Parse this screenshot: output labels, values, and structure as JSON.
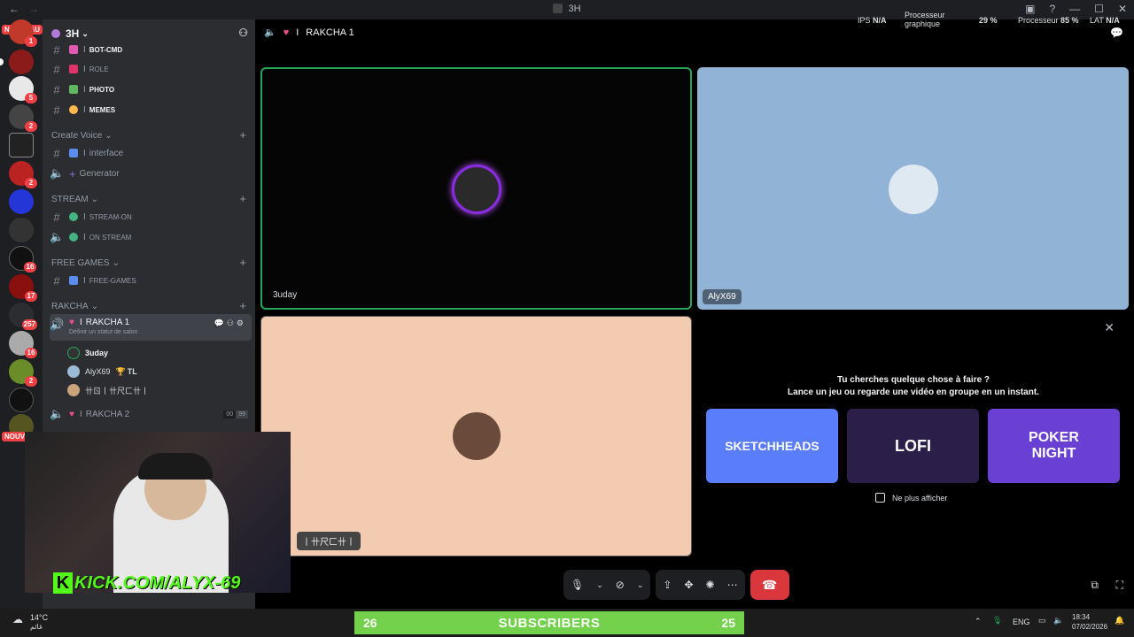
{
  "window": {
    "title": "3H"
  },
  "server": {
    "name": "3H"
  },
  "nouveau_label": "NOUVEAU",
  "server_badges": [
    "1",
    "5",
    "2",
    "2",
    "16",
    "17",
    "257",
    "16",
    "2"
  ],
  "channels": {
    "text_top": [
      {
        "label": "BOT-CMD",
        "color": "#e05bb0"
      },
      {
        "label": "ROLE",
        "color": "#e0336a"
      },
      {
        "label": "PHOTO",
        "color": "#5fb85f"
      },
      {
        "label": "MEMES",
        "color": "#ffb84d"
      }
    ],
    "create_voice": {
      "label": "Create Voice",
      "items": [
        {
          "label": "interface",
          "type": "text"
        },
        {
          "label": "Generator",
          "type": "voice"
        }
      ]
    },
    "stream": {
      "label": "STREAM",
      "items": [
        {
          "label": "STREAM-ON",
          "type": "text"
        },
        {
          "label": "ON STREAM",
          "type": "voice"
        }
      ]
    },
    "free_games": {
      "label": "FREE GAMES",
      "items": [
        {
          "label": "FREE-GAMES",
          "type": "text"
        }
      ]
    },
    "rakcha": {
      "label": "RAKCHA",
      "active": {
        "label": "RAKCHA 1",
        "status": "Définir un statut de salon"
      },
      "users": [
        {
          "name": "3uday"
        },
        {
          "name": "AlyX69",
          "tag": "TL"
        },
        {
          "name": "卄ㄖ丨卄尺ㄈ卄丨"
        }
      ],
      "next": {
        "label": "RAKCHA 2",
        "counter": [
          "00",
          "99"
        ]
      }
    },
    "separator": "I"
  },
  "call": {
    "channel_label": "RAKCHA 1",
    "stats": {
      "ips_label": "IPS",
      "ips_value": "N/A",
      "gpu_label": "Processeur graphique",
      "gpu_value": "29 %",
      "cpu_label": "Processeur",
      "cpu_value": "85 %",
      "lat_label": "LAT",
      "lat_value": "N/A"
    },
    "tiles": [
      {
        "name": "3uday"
      },
      {
        "name": "AlyX69"
      },
      {
        "name": "丨卄尺ㄈ卄丨"
      }
    ]
  },
  "activity": {
    "line1": "Tu cherches quelque chose à faire ?",
    "line2": "Lance un jeu ou regarde une vidéo en groupe en un instant.",
    "cards": [
      {
        "label": "SKETCHHEADS",
        "bg": "#5a7dfb"
      },
      {
        "label": "LOFI",
        "bg": "#2b1f4a"
      },
      {
        "label": "POKER NIGHT",
        "bg": "#6a3fd4"
      }
    ],
    "dont_show": "Ne plus afficher"
  },
  "overlay": {
    "kick_url": "KICK.COM/ALYX-69",
    "subs_left": "26",
    "subs_label": "SUBSCRIBERS",
    "subs_right": "25"
  },
  "taskbar": {
    "weather": "14°C",
    "weather_sub": "غائم",
    "lang": "ENG",
    "time": "18:34",
    "date": "07/02/2026"
  },
  "colors": {
    "speaking": "#23a55a",
    "accent": "#5865f2",
    "hangup": "#da373c"
  }
}
